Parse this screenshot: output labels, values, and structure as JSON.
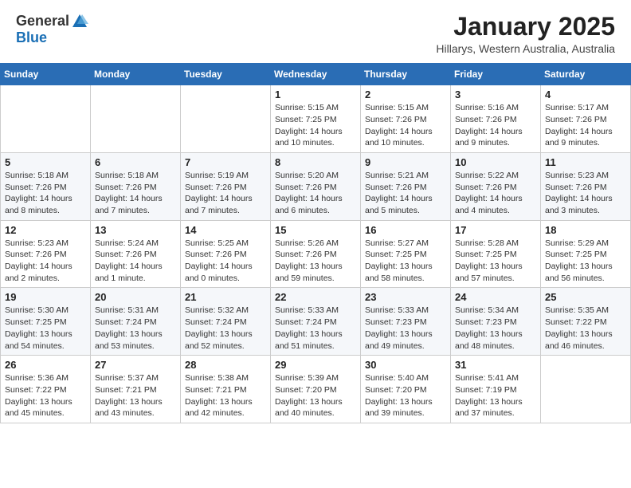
{
  "header": {
    "logo_general": "General",
    "logo_blue": "Blue",
    "month_year": "January 2025",
    "location": "Hillarys, Western Australia, Australia"
  },
  "days_of_week": [
    "Sunday",
    "Monday",
    "Tuesday",
    "Wednesday",
    "Thursday",
    "Friday",
    "Saturday"
  ],
  "weeks": [
    [
      {
        "day": "",
        "info": ""
      },
      {
        "day": "",
        "info": ""
      },
      {
        "day": "",
        "info": ""
      },
      {
        "day": "1",
        "info": "Sunrise: 5:15 AM\nSunset: 7:25 PM\nDaylight: 14 hours\nand 10 minutes."
      },
      {
        "day": "2",
        "info": "Sunrise: 5:15 AM\nSunset: 7:26 PM\nDaylight: 14 hours\nand 10 minutes."
      },
      {
        "day": "3",
        "info": "Sunrise: 5:16 AM\nSunset: 7:26 PM\nDaylight: 14 hours\nand 9 minutes."
      },
      {
        "day": "4",
        "info": "Sunrise: 5:17 AM\nSunset: 7:26 PM\nDaylight: 14 hours\nand 9 minutes."
      }
    ],
    [
      {
        "day": "5",
        "info": "Sunrise: 5:18 AM\nSunset: 7:26 PM\nDaylight: 14 hours\nand 8 minutes."
      },
      {
        "day": "6",
        "info": "Sunrise: 5:18 AM\nSunset: 7:26 PM\nDaylight: 14 hours\nand 7 minutes."
      },
      {
        "day": "7",
        "info": "Sunrise: 5:19 AM\nSunset: 7:26 PM\nDaylight: 14 hours\nand 7 minutes."
      },
      {
        "day": "8",
        "info": "Sunrise: 5:20 AM\nSunset: 7:26 PM\nDaylight: 14 hours\nand 6 minutes."
      },
      {
        "day": "9",
        "info": "Sunrise: 5:21 AM\nSunset: 7:26 PM\nDaylight: 14 hours\nand 5 minutes."
      },
      {
        "day": "10",
        "info": "Sunrise: 5:22 AM\nSunset: 7:26 PM\nDaylight: 14 hours\nand 4 minutes."
      },
      {
        "day": "11",
        "info": "Sunrise: 5:23 AM\nSunset: 7:26 PM\nDaylight: 14 hours\nand 3 minutes."
      }
    ],
    [
      {
        "day": "12",
        "info": "Sunrise: 5:23 AM\nSunset: 7:26 PM\nDaylight: 14 hours\nand 2 minutes."
      },
      {
        "day": "13",
        "info": "Sunrise: 5:24 AM\nSunset: 7:26 PM\nDaylight: 14 hours\nand 1 minute."
      },
      {
        "day": "14",
        "info": "Sunrise: 5:25 AM\nSunset: 7:26 PM\nDaylight: 14 hours\nand 0 minutes."
      },
      {
        "day": "15",
        "info": "Sunrise: 5:26 AM\nSunset: 7:26 PM\nDaylight: 13 hours\nand 59 minutes."
      },
      {
        "day": "16",
        "info": "Sunrise: 5:27 AM\nSunset: 7:25 PM\nDaylight: 13 hours\nand 58 minutes."
      },
      {
        "day": "17",
        "info": "Sunrise: 5:28 AM\nSunset: 7:25 PM\nDaylight: 13 hours\nand 57 minutes."
      },
      {
        "day": "18",
        "info": "Sunrise: 5:29 AM\nSunset: 7:25 PM\nDaylight: 13 hours\nand 56 minutes."
      }
    ],
    [
      {
        "day": "19",
        "info": "Sunrise: 5:30 AM\nSunset: 7:25 PM\nDaylight: 13 hours\nand 54 minutes."
      },
      {
        "day": "20",
        "info": "Sunrise: 5:31 AM\nSunset: 7:24 PM\nDaylight: 13 hours\nand 53 minutes."
      },
      {
        "day": "21",
        "info": "Sunrise: 5:32 AM\nSunset: 7:24 PM\nDaylight: 13 hours\nand 52 minutes."
      },
      {
        "day": "22",
        "info": "Sunrise: 5:33 AM\nSunset: 7:24 PM\nDaylight: 13 hours\nand 51 minutes."
      },
      {
        "day": "23",
        "info": "Sunrise: 5:33 AM\nSunset: 7:23 PM\nDaylight: 13 hours\nand 49 minutes."
      },
      {
        "day": "24",
        "info": "Sunrise: 5:34 AM\nSunset: 7:23 PM\nDaylight: 13 hours\nand 48 minutes."
      },
      {
        "day": "25",
        "info": "Sunrise: 5:35 AM\nSunset: 7:22 PM\nDaylight: 13 hours\nand 46 minutes."
      }
    ],
    [
      {
        "day": "26",
        "info": "Sunrise: 5:36 AM\nSunset: 7:22 PM\nDaylight: 13 hours\nand 45 minutes."
      },
      {
        "day": "27",
        "info": "Sunrise: 5:37 AM\nSunset: 7:21 PM\nDaylight: 13 hours\nand 43 minutes."
      },
      {
        "day": "28",
        "info": "Sunrise: 5:38 AM\nSunset: 7:21 PM\nDaylight: 13 hours\nand 42 minutes."
      },
      {
        "day": "29",
        "info": "Sunrise: 5:39 AM\nSunset: 7:20 PM\nDaylight: 13 hours\nand 40 minutes."
      },
      {
        "day": "30",
        "info": "Sunrise: 5:40 AM\nSunset: 7:20 PM\nDaylight: 13 hours\nand 39 minutes."
      },
      {
        "day": "31",
        "info": "Sunrise: 5:41 AM\nSunset: 7:19 PM\nDaylight: 13 hours\nand 37 minutes."
      },
      {
        "day": "",
        "info": ""
      }
    ]
  ]
}
